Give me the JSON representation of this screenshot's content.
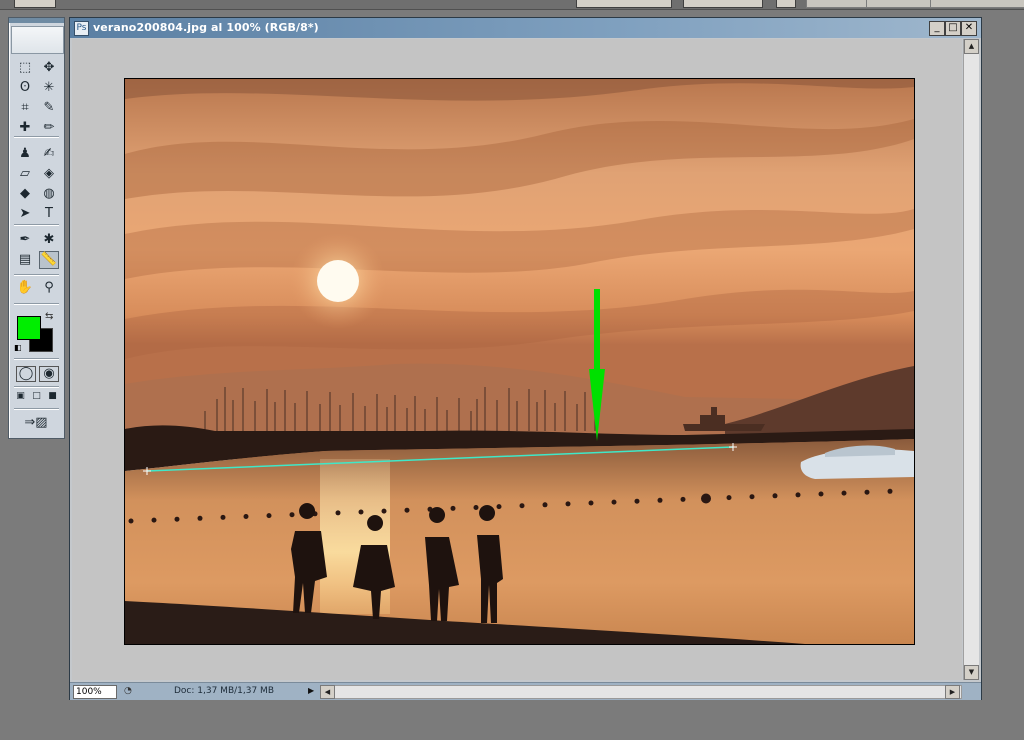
{
  "window": {
    "title": "verano200804.jpg al 100% (RGB/8*)",
    "minimize_label": "_",
    "maximize_label": "□",
    "close_label": "✕"
  },
  "status": {
    "zoom": "100%",
    "doc_info": "Doc: 1,37 MB/1,37 MB"
  },
  "toolbox": {
    "foreground_color": "#00ee00",
    "background_color": "#000000",
    "tools": [
      {
        "name": "marquee-tool-icon",
        "glyph": "⬚"
      },
      {
        "name": "move-tool-icon",
        "glyph": "✥"
      },
      {
        "name": "lasso-tool-icon",
        "glyph": "ʘ"
      },
      {
        "name": "magic-wand-tool-icon",
        "glyph": "✳"
      },
      {
        "name": "crop-tool-icon",
        "glyph": "⌗"
      },
      {
        "name": "slice-tool-icon",
        "glyph": "✎"
      },
      {
        "name": "healing-brush-tool-icon",
        "glyph": "✚"
      },
      {
        "name": "brush-tool-icon",
        "glyph": "✏"
      },
      {
        "name": "stamp-tool-icon",
        "glyph": "♟"
      },
      {
        "name": "history-brush-tool-icon",
        "glyph": "✍"
      },
      {
        "name": "eraser-tool-icon",
        "glyph": "▱"
      },
      {
        "name": "paint-bucket-tool-icon",
        "glyph": "◈"
      },
      {
        "name": "blur-tool-icon",
        "glyph": "◆"
      },
      {
        "name": "dodge-tool-icon",
        "glyph": "◍"
      },
      {
        "name": "path-selection-tool-icon",
        "glyph": "➤"
      },
      {
        "name": "type-tool-icon",
        "glyph": "T"
      },
      {
        "name": "pen-tool-icon",
        "glyph": "✒"
      },
      {
        "name": "custom-shape-tool-icon",
        "glyph": "✱"
      },
      {
        "name": "notes-tool-icon",
        "glyph": "▤"
      },
      {
        "name": "measure-tool-icon",
        "glyph": "📏"
      },
      {
        "name": "hand-tool-icon",
        "glyph": "✋"
      },
      {
        "name": "zoom-tool-icon",
        "glyph": "⚲"
      }
    ]
  },
  "accent_colors": {
    "arrow": "#00e000",
    "measure_line": "#3fe8c8"
  }
}
